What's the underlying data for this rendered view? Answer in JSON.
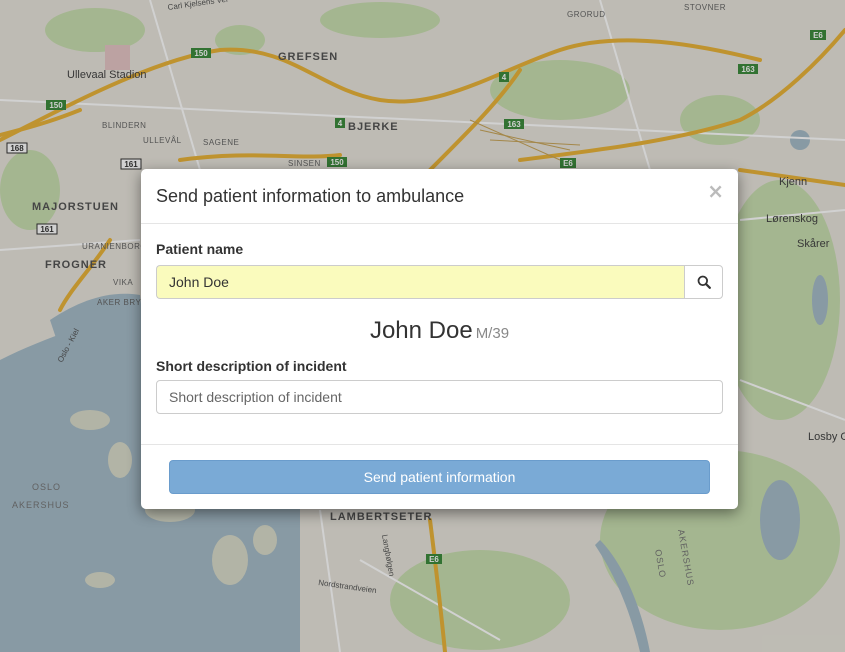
{
  "map": {
    "districts": {
      "grefsen": "GREFSEN",
      "bjerke": "BJERKE",
      "majorstuen": "MAJORSTUEN",
      "frogner": "FROGNER",
      "blindern": "BLINDERN",
      "ullevaal": "ULLEVÅL",
      "sagene": "SAGENE",
      "sinsen": "SINSEN",
      "uranienborg": "URANIENBORG",
      "vika": "VIKA",
      "aker_brygge": "AKER BRYGGE",
      "grorud": "GRORUD",
      "stovner": "STOVNER",
      "lambertseter": "LAMBERTSETER",
      "oslo": "OSLO",
      "akershus": "AKERSHUS"
    },
    "places": {
      "ullevaal_stadion": "Ullevaal Stadion",
      "kjenn": "Kjenn",
      "lorenskog": "Lørenskog",
      "skarer": "Skårer",
      "losby": "Losby G",
      "oslo_sw": "OSLO",
      "akershus_sw": "AKERSHUS",
      "akershus_se": "AKERSHUS",
      "oslo_se": "OSLO"
    },
    "roads": {
      "carl_kjelsens_vei": "Carl Kjelsens Vei",
      "nordstrandveien": "Nordstrandveien",
      "langbolgen": "Langbølgen",
      "oslo_kiel": "Oslo - Kiel"
    },
    "shields": [
      "150",
      "150",
      "150",
      "168",
      "161",
      "161",
      "4",
      "4",
      "163",
      "163",
      "E6",
      "E6",
      "E6"
    ]
  },
  "modal": {
    "title": "Send patient information to ambulance",
    "close_symbol": "×",
    "patient_name_label": "Patient name",
    "patient_name_value": "John Doe",
    "search_icon": "search-icon",
    "patient_display_name": "John Doe",
    "patient_meta": "M/39",
    "description_label": "Short description of incident",
    "description_placeholder": "Short description of incident",
    "description_value": "",
    "send_button_label": "Send patient information"
  },
  "colors": {
    "input_highlight": "#fafbbd",
    "send_button": "#7aaad6",
    "water": "#a6bcc9",
    "land": "#e9e6de",
    "road_major": "#e9b43a"
  }
}
